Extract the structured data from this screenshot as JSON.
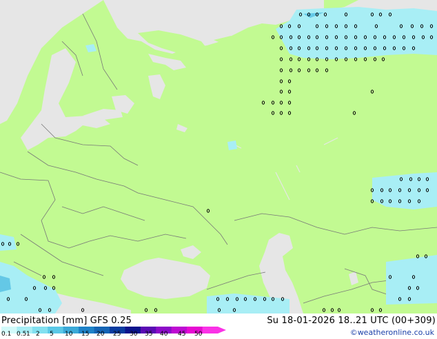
{
  "map": {
    "colors": {
      "land": "#c2fa92",
      "sea": "#e6e6e6",
      "border": "#777777",
      "coast": "#9a9a9a",
      "precip_light": "#a8eef5",
      "precip_med": "#64c8e6",
      "marker": "#000000"
    }
  },
  "footer": {
    "title": "Precipitation [mm]  GFS 0.25",
    "datetime": "Su 18-01-2026 18..21 UTC (00+309)",
    "credit": "©weatheronline.co.uk",
    "legend": {
      "ticks": [
        "0.1",
        "0.5",
        "1",
        "2",
        "5",
        "10",
        "15",
        "20",
        "25",
        "30",
        "35",
        "40",
        "45",
        "50"
      ],
      "colors": [
        "#d2fafa",
        "#a8eef5",
        "#82e0f0",
        "#5ac8e6",
        "#3caad8",
        "#1e82c8",
        "#1464b4",
        "#0a3ca0",
        "#0a148c",
        "#5a0ab4",
        "#8c0ac8",
        "#be0ad2",
        "#e60ad2",
        "#fa32e6"
      ]
    }
  }
}
